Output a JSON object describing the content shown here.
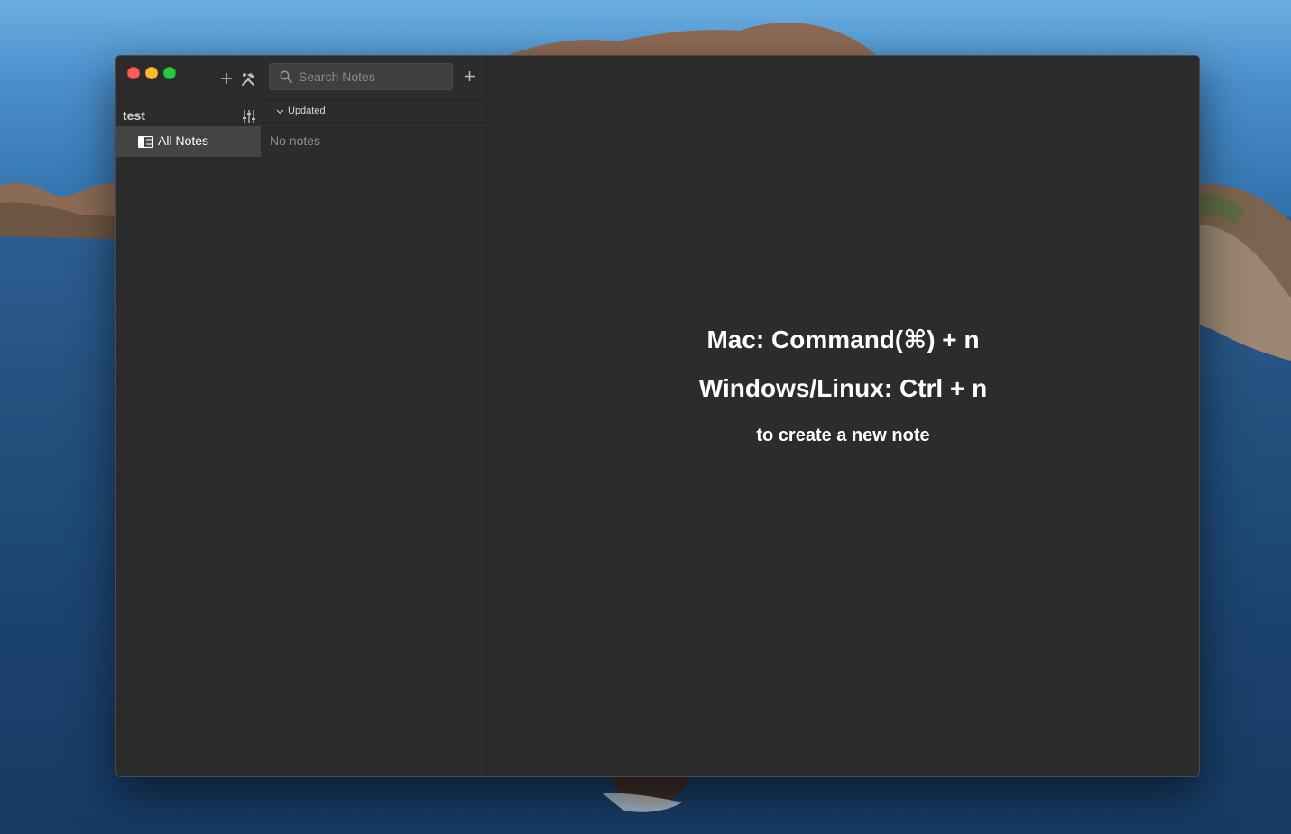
{
  "sidebar": {
    "add_icon": "plus-icon",
    "tools_icon": "wrench-hammer-icon",
    "storage": {
      "name": "test",
      "config_icon": "sliders-icon"
    },
    "items": [
      {
        "label": "All Notes",
        "icon": "all-notes-icon"
      }
    ]
  },
  "note_list": {
    "search": {
      "placeholder": "Search Notes",
      "value": "",
      "icon": "search-icon"
    },
    "new_note_icon": "plus-icon",
    "sort": {
      "label": "Updated",
      "icon": "chevron-down-icon"
    },
    "empty_text": "No notes"
  },
  "editor": {
    "hint_mac": "Mac: Command(⌘) + n",
    "hint_windows": "Windows/Linux: Ctrl + n",
    "hint_sub": "to create a new note"
  },
  "colors": {
    "window_bg": "#2c2c2c",
    "sidebar_selected": "#444444",
    "traffic_close": "#ff5f57",
    "traffic_minimize": "#febc2e",
    "traffic_maximize": "#28c840"
  }
}
